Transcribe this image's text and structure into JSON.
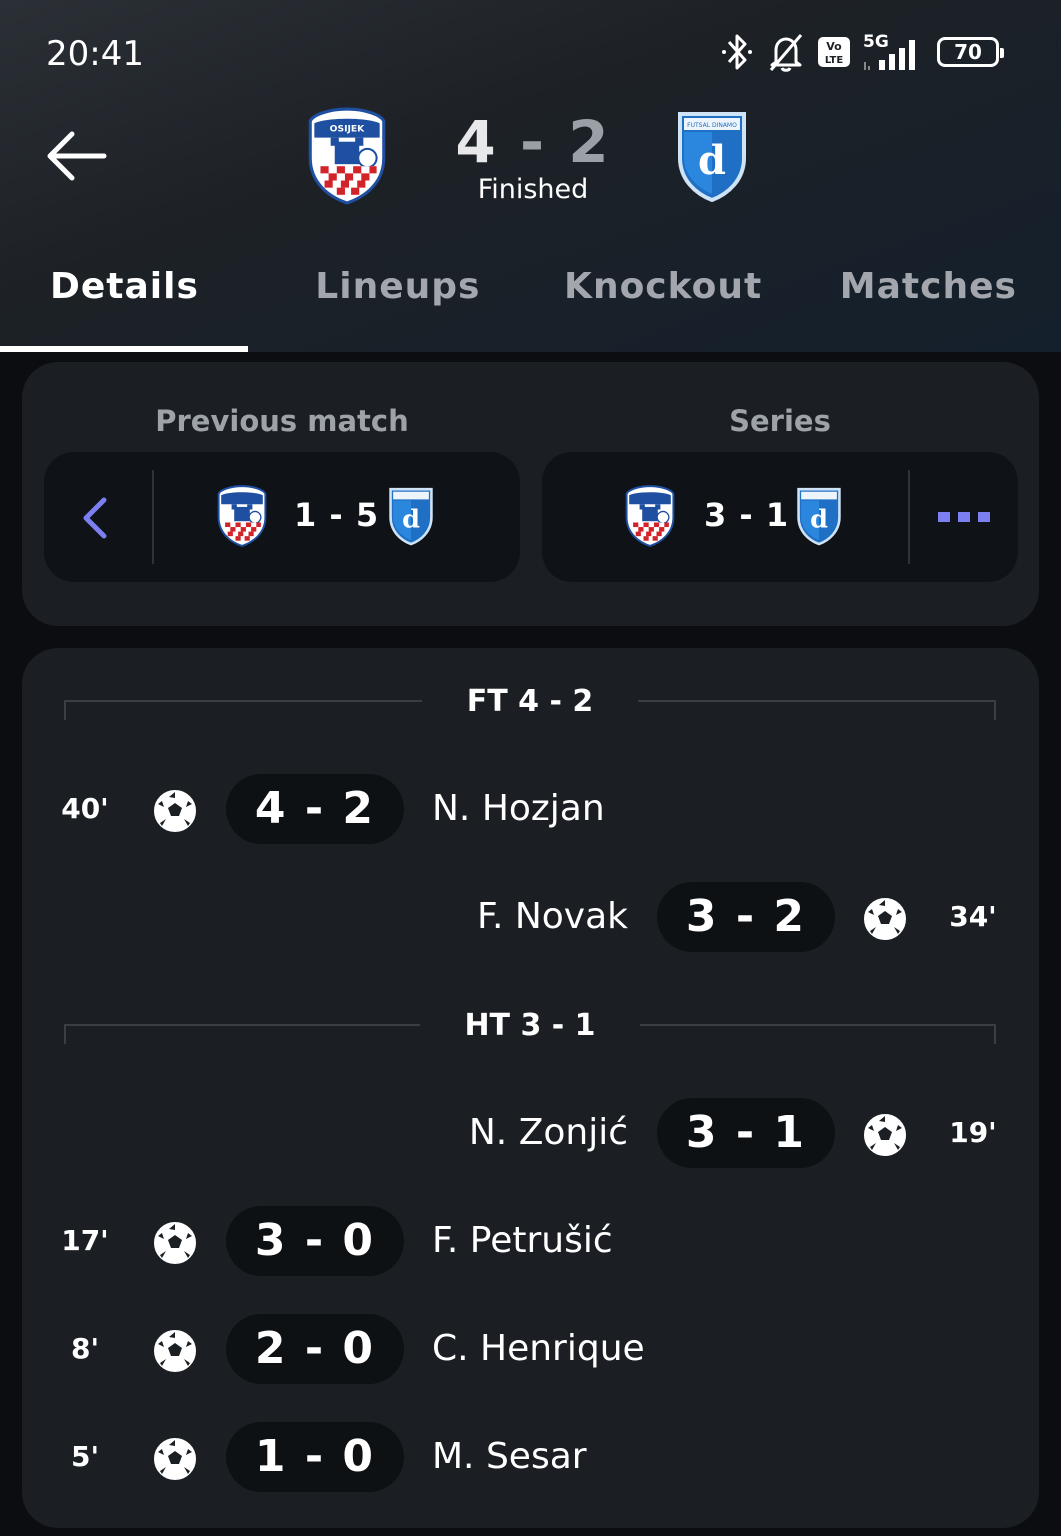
{
  "status_bar": {
    "time": "20:41",
    "network": "5G",
    "volte": "Vo LTE",
    "battery": "70",
    "icons": [
      "bluetooth-icon",
      "bell-off-icon",
      "volte-icon",
      "signal-icon",
      "battery-icon"
    ]
  },
  "header": {
    "home_team_crest": "futsal-klub-osijek-crest",
    "away_team_crest": "futsal-dinamo-crest",
    "home_crest_text": "OSIJEK",
    "away_crest_text": "FUTSAL DINAMO",
    "away_crest_letter": "d",
    "score_home": "4",
    "score_sep": "-",
    "score_away": "2",
    "status": "Finished"
  },
  "tabs": [
    {
      "label": "Details",
      "active": true
    },
    {
      "label": "Lineups",
      "active": false
    },
    {
      "label": "Knockout",
      "active": false
    },
    {
      "label": "Matches",
      "active": false
    }
  ],
  "previous_match": {
    "label": "Previous match",
    "score": "1 - 5"
  },
  "series": {
    "label": "Series",
    "score": "3 - 1"
  },
  "sections": [
    {
      "label": "FT 4 - 2"
    },
    {
      "label": "HT 3 - 1"
    }
  ],
  "events": [
    {
      "minute": "40'",
      "score": "4 - 2",
      "player": "N. Hozjan",
      "side": "home"
    },
    {
      "minute": "34'",
      "score": "3 - 2",
      "player": "F. Novak",
      "side": "away"
    },
    {
      "minute": "19'",
      "score": "3 - 1",
      "player": "N. Zonjić",
      "side": "away"
    },
    {
      "minute": "17'",
      "score": "3 - 0",
      "player": "F. Petrušić",
      "side": "home"
    },
    {
      "minute": "8'",
      "score": "2 - 0",
      "player": "C. Henrique",
      "side": "home"
    },
    {
      "minute": "5'",
      "score": "1 - 0",
      "player": "M. Sesar",
      "side": "home"
    }
  ],
  "colors": {
    "accent": "#7b7ff0",
    "card_bg": "#1b1f24",
    "pill_bg": "#0f1216",
    "home_red": "#d2232a",
    "away_blue": "#1f6fc4"
  }
}
